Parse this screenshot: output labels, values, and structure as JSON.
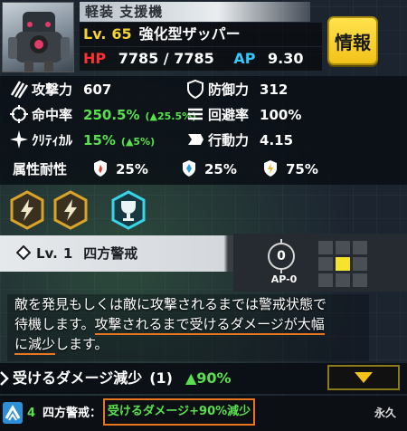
{
  "header": {
    "unit_type": "軽装 支援機",
    "lv_label": "Lv.",
    "lv_value": "65",
    "unit_name": "強化型ザッパー",
    "hp_label": "HP",
    "hp_value": "7785 / 7785",
    "ap_label": "AP",
    "ap_value": "9.30",
    "info_button": "情報"
  },
  "stats": {
    "attack_label": "攻撃力",
    "attack_value": "607",
    "defense_label": "防御力",
    "defense_value": "312",
    "accuracy_label": "命中率",
    "accuracy_value": "250.5%",
    "accuracy_bonus": "(▲25.5%)",
    "evasion_label": "回避率",
    "evasion_value": "100%",
    "critical_label": "ｸﾘﾃｨｶﾙ",
    "critical_value": "15%",
    "critical_bonus": "(▲5%)",
    "action_label": "行動力",
    "action_value": "4.15",
    "resist_label": "属性耐性",
    "resist_fire": "25%",
    "resist_ice": "25%",
    "resist_electric": "75%"
  },
  "skill": {
    "lv_label": "Lv.",
    "lv_value": "1",
    "name": "四方警戒",
    "ap_cost_circle": "0",
    "ap_cost_label": "AP-0",
    "description_line1": "敵を発見もしくは敵に攻撃されるまでは警戒状態で",
    "description_line2a": "待機します。",
    "description_line2b": "攻撃されるまで受けるダメージが大幅",
    "description_line3a": "に減少",
    "description_line3b": "します。"
  },
  "effect": {
    "name": "受けるダメージ減少",
    "count": "(1)",
    "percent": "▲90%"
  },
  "status": {
    "number": "4",
    "skill": "四方警戒：",
    "effect": "受けるダメージ+90%減少",
    "duration": "永久"
  },
  "colors": {
    "lv_yellow": "#f3d232",
    "hp_red": "#ff3030",
    "ap_blue": "#35c8ff",
    "buff_green": "#58e04e",
    "highlight_orange": "#e8761e",
    "info_button_yellow": "#f3c21a"
  },
  "icons": {
    "attack": "claw-slash-icon",
    "defense": "shield-icon",
    "accuracy": "crosshair-icon",
    "evasion": "speed-lines-icon",
    "critical": "sparkle-star-icon",
    "action": "arrow-chevron-icon",
    "fire_resist": "fire-shield-icon",
    "ice_resist": "ice-shield-icon",
    "electric_resist": "lightning-shield-icon",
    "skill_1": "lightning-hex-icon",
    "skill_2": "lightning-hex-icon",
    "skill_3": "trophy-hex-icon",
    "skill_diamond": "diamond-icon",
    "expand": "triangle-down-icon",
    "buff": "buff-arrow-icon"
  }
}
